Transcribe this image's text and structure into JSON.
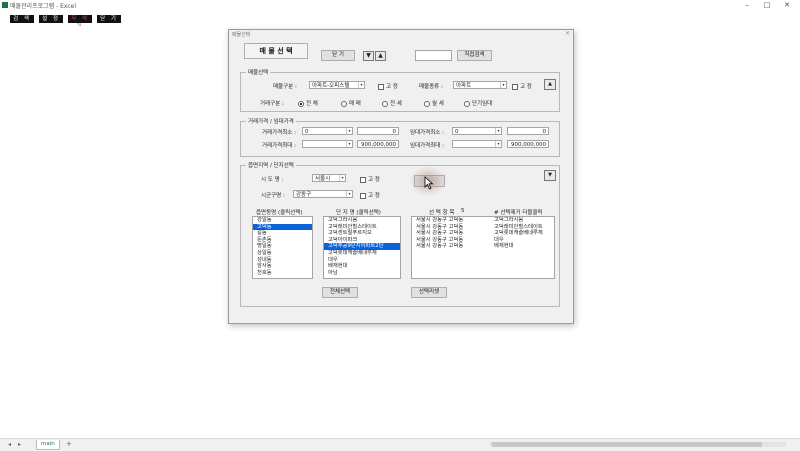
{
  "app": {
    "title": "매물관리프로그램 - Excel",
    "window_controls": [
      "–",
      "□",
      "✕"
    ]
  },
  "toolbar": {
    "buttons": [
      "검 색",
      "설 정",
      "자 석 관",
      "닫 기"
    ],
    "accent": "#111111"
  },
  "sheet": {
    "tab": "main",
    "nav": [
      "◂",
      "▸"
    ],
    "add": "+"
  },
  "dialog": {
    "title": "매물선택",
    "close": "✕",
    "header_label": "매 물 선 택",
    "close_button": "닫 기",
    "down_arrow": "▼",
    "up_arrow": "▲",
    "direct_search_button": "직접검색",
    "property_section": {
      "label": "매물선택",
      "type_label": "매물구분 :",
      "type_value": "아파트-오피스텔",
      "fixed1": "고 정",
      "kind_label": "매물종류 :",
      "kind_value": "아파트",
      "fixed2": "고 정",
      "deal_label": "거래구분 :",
      "deal_options": [
        "전 체",
        "매 매",
        "전 세",
        "월 세",
        "단기임대"
      ],
      "up_btn": "▲"
    },
    "price_section": {
      "label": "거래가격 / 임대가격",
      "min_label": "거래가격최소 :",
      "min_combo": "0",
      "min_box": "0",
      "max_label": "거래가격최대 :",
      "max_combo": "",
      "max_box": "900,000,000",
      "rent_min_label": "임대가격최소 :",
      "rent_min_combo": "0",
      "rent_min_box": "0",
      "rent_max_label": "임대가격최대 :",
      "rent_max_combo": "",
      "rent_max_box": "900,000,000"
    },
    "region_section": {
      "label": "읍면지역 / 단지선택",
      "city_label": "시 도 명 :",
      "city_value": "서울시",
      "city_fixed": "고 정",
      "district_label": "시군구명 :",
      "district_value": "강동구",
      "district_fixed": "고 정",
      "down_btn": "▼",
      "dong_header": "읍면동명 (클릭선택)",
      "dongs": [
        "강일동",
        "고덕동",
        "길동",
        "둔촌동",
        "명일동",
        "상일동",
        "성내동",
        "암사동",
        "천호동"
      ],
      "dong_selected": 1,
      "complex_header": "단 지 명 (클릭선택)",
      "complexes": [
        "고덕그라시움",
        "고덕래미안힐스테이트",
        "고덕센트럴푸르지오",
        "고덕아이파크",
        "고덕주공9단지아파트2단",
        "고덕롯데캐슬베네루체",
        "대우",
        "배재현대",
        "아남"
      ],
      "complex_selected": 4,
      "sel_items_header": "선 택 항 목",
      "sel_count": "5",
      "sel_remove_header": "# 선택제거 더블클릭",
      "selected_rows": [
        [
          "서울시 강동구 고덕동",
          "고덕그라시움"
        ],
        [
          "서울시 강동구 고덕동",
          "고덕래미안힐스테이트"
        ],
        [
          "서울시 강동구 고덕동",
          "고덕롯데캐슬베네루체"
        ],
        [
          "서울시 강동구 고덕동",
          "대우"
        ],
        [
          "서울시 강동구 고덕동",
          "배재현대"
        ]
      ],
      "select_all_button": "전체선택",
      "reset_button": "선택리셋"
    }
  }
}
